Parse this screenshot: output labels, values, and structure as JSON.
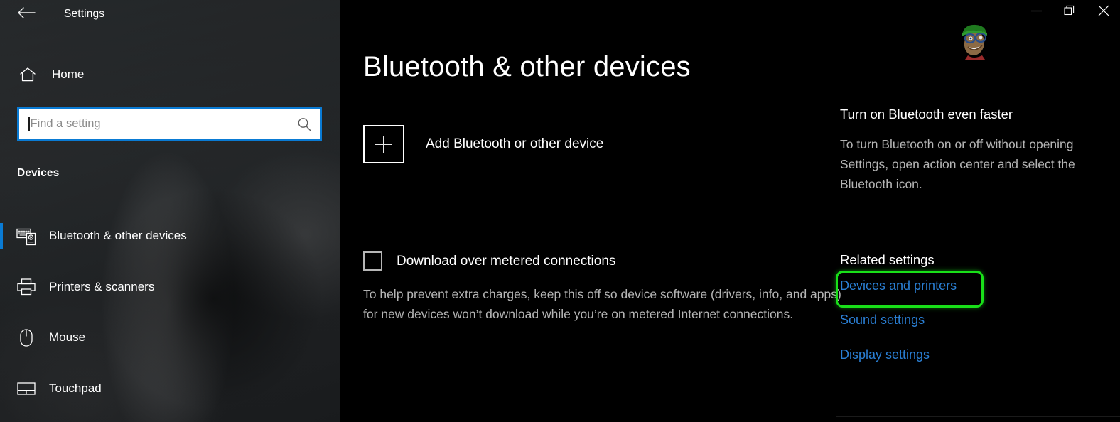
{
  "window": {
    "title": "Settings",
    "back_icon": "back-arrow-icon",
    "controls": {
      "minimize": "minimize-icon",
      "maximize": "maximize-icon",
      "close": "close-icon"
    }
  },
  "sidebar": {
    "home_label": "Home",
    "home_icon": "home-icon",
    "search": {
      "value": "",
      "placeholder": "Find a setting",
      "icon": "search-icon"
    },
    "section_header": "Devices",
    "items": [
      {
        "label": "Bluetooth & other devices",
        "icon": "bluetooth-devices-icon",
        "selected": true
      },
      {
        "label": "Printers & scanners",
        "icon": "printer-icon",
        "selected": false
      },
      {
        "label": "Mouse",
        "icon": "mouse-icon",
        "selected": false
      },
      {
        "label": "Touchpad",
        "icon": "touchpad-icon",
        "selected": false
      }
    ],
    "accent_color": "#0a7bd4"
  },
  "main": {
    "page_title": "Bluetooth & other devices",
    "add_device": {
      "label": "Add Bluetooth or other device",
      "icon": "plus-icon"
    },
    "metered": {
      "label": "Download over metered connections",
      "checked": false,
      "description": "To help prevent extra charges, keep this off so device software (drivers, info, and apps) for new devices won’t download while you’re on metered Internet connections."
    }
  },
  "right_panel": {
    "tip_heading": "Turn on Bluetooth even faster",
    "tip_body": "To turn Bluetooth on or off without opening Settings, open action center and select the Bluetooth icon.",
    "related_heading": "Related settings",
    "links": [
      {
        "label": "Devices and printers",
        "highlighted": true
      },
      {
        "label": "Sound settings",
        "highlighted": false
      },
      {
        "label": "Display settings",
        "highlighted": false
      }
    ],
    "link_color": "#2a7fd4",
    "highlight_color": "#19e019"
  }
}
